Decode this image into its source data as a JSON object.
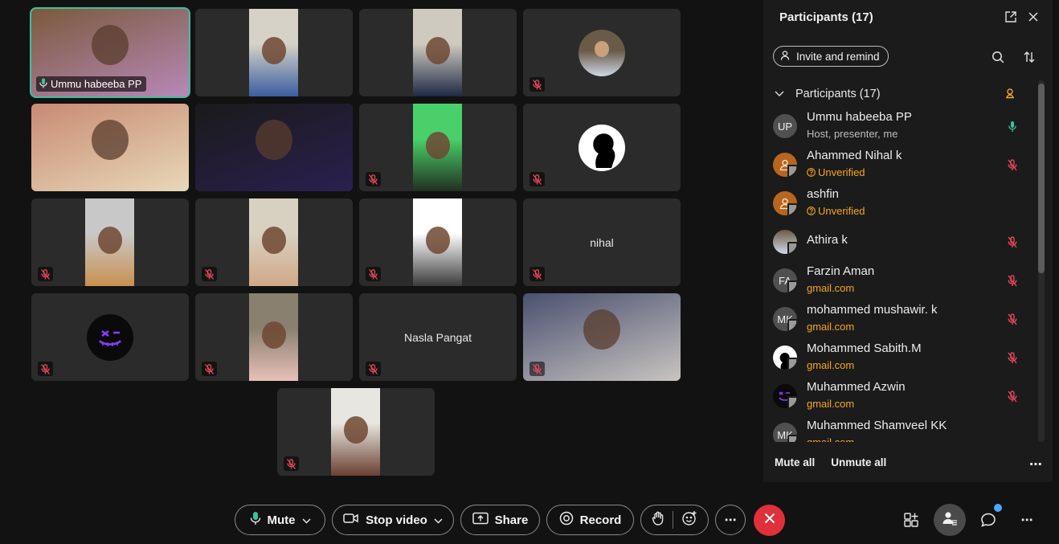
{
  "tiles": [
    {
      "name": "Ummu habeeba  PP",
      "active": true,
      "muted": false,
      "colors": [
        "#7a5a3c",
        "#b888b8"
      ]
    },
    {
      "muted": false,
      "colors": [
        "#d6d2c8",
        "#3a5ea0"
      ]
    },
    {
      "muted": false,
      "colors": [
        "#cfcac0",
        "#1e2a44"
      ]
    },
    {
      "muted": true,
      "avatar": "photo",
      "colors": [
        "#6a5a48",
        "#cfd8e6"
      ]
    },
    {
      "muted": false,
      "colors": [
        "#c88a72",
        "#e8d8b8"
      ]
    },
    {
      "muted": false,
      "colors": [
        "#1a1a1a",
        "#2a2050"
      ]
    },
    {
      "muted": true,
      "colors": [
        "#4ad06a",
        "#203020"
      ]
    },
    {
      "muted": true,
      "avatar": "silhouette",
      "colors": [
        "#ffffff",
        "#000000"
      ]
    },
    {
      "muted": true,
      "colors": [
        "#c8c8c8",
        "#c89050"
      ]
    },
    {
      "muted": true,
      "colors": [
        "#d8d0c0",
        "#d0a888"
      ]
    },
    {
      "muted": true,
      "colors": [
        "#ffffff",
        "#3a3a3a"
      ]
    },
    {
      "name": "nihal",
      "muted": true
    },
    {
      "muted": true,
      "avatar": "dark",
      "colors": [
        "#0a0a0a",
        "#8a3cff"
      ]
    },
    {
      "muted": true,
      "colors": [
        "#8a8070",
        "#e8c0b8"
      ]
    },
    {
      "name": "Nasla Pangat",
      "muted": true
    },
    {
      "muted": true,
      "colors": [
        "#4a5070",
        "#c8c4c0"
      ]
    },
    {
      "muted": true,
      "colors": [
        "#e8e6e0",
        "#6a4030"
      ]
    }
  ],
  "panel": {
    "title": "Participants (17)",
    "invite_label": "Invite and remind",
    "section_label": "Participants (17)",
    "participants": [
      {
        "initials": "UP",
        "name": "Ummu habeeba  PP",
        "sub": "Host, presenter, me",
        "sub_style": "gray",
        "status": "mic-on"
      },
      {
        "initials": "",
        "avatar": "generic-orange",
        "name": "Ahammed Nihal k",
        "sub": "Unverified",
        "sub_style": "orange-q",
        "status": "mic-off"
      },
      {
        "initials": "",
        "avatar": "generic-orange",
        "name": "ashfin",
        "sub": "Unverified",
        "sub_style": "orange-q",
        "status": "none"
      },
      {
        "initials": "",
        "avatar": "photo",
        "name": "Athira  k",
        "sub": "",
        "sub_style": "gray",
        "status": "mic-off"
      },
      {
        "initials": "FA",
        "name": "Farzin Aman",
        "sub": "gmail.com",
        "sub_style": "orange",
        "status": "mic-off"
      },
      {
        "initials": "MK",
        "name": "mohammed mushawir. k",
        "sub": "gmail.com",
        "sub_style": "orange",
        "status": "mic-off"
      },
      {
        "initials": "",
        "avatar": "silhouette",
        "name": "Mohammed Sabith.M",
        "sub": "gmail.com",
        "sub_style": "orange",
        "status": "mic-off"
      },
      {
        "initials": "",
        "avatar": "dark",
        "name": "Muhammed Azwin",
        "sub": "gmail.com",
        "sub_style": "orange",
        "status": "mic-off"
      },
      {
        "initials": "MK",
        "name": "Muhammed Shamveel KK",
        "sub": "gmail.com",
        "sub_style": "orange",
        "status": "none"
      }
    ],
    "mute_all": "Mute all",
    "unmute_all": "Unmute all"
  },
  "toolbar": {
    "mute": "Mute",
    "stop_video": "Stop video",
    "share": "Share",
    "record": "Record"
  },
  "colors": {
    "accent_green": "#3fbf9e",
    "mute_red": "#e8485a",
    "end_call": "#e0303a",
    "orange": "#f5a623",
    "notify_blue": "#4aa8ff"
  }
}
